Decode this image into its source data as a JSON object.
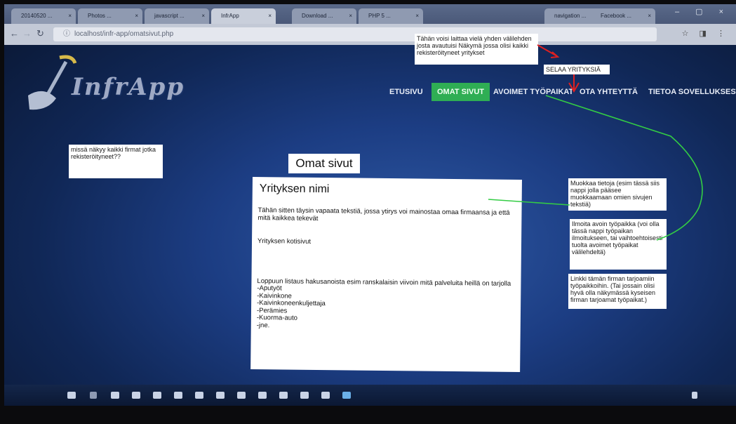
{
  "browser": {
    "tabs": [
      {
        "label": "20140520 ..."
      },
      {
        "label": "Photos ..."
      },
      {
        "label": "javascript ..."
      },
      {
        "label": "InfrApp"
      },
      {
        "label": "Download ..."
      },
      {
        "label": "PHP 5 ..."
      },
      {
        "label": "navigation ..."
      },
      {
        "label": "Facebook ..."
      }
    ],
    "url": "localhost/infr-app/omatsivut.php"
  },
  "site": {
    "logo": "InfrApp",
    "nav": [
      {
        "label": "ETUSIVU"
      },
      {
        "label": "OMAT SIVUT",
        "active": true
      },
      {
        "label": "AVOIMET TYÖPAIKAT"
      },
      {
        "label": "OTA YHTEYTTÄ"
      },
      {
        "label": "TIETOA SOVELLUKSESTA"
      }
    ]
  },
  "page": {
    "title": "Omat sivut",
    "company_name": "Yrityksen nimi",
    "description": "Tähän sitten täysin vapaata tekstiä, jossa ytirys voi mainostaa omaa firmaansa ja että mitä kaikkea tekevät",
    "homepage_label": "Yrityksen kotisivut",
    "list_intro": "Loppuun listaus hakusanoista esim ranskalaisin viivoin mitä palveluita heillä on tarjolla",
    "list_items": [
      "-Aputyöt",
      "-Kaivinkone",
      "-Kaivinkoneenkuljettaja",
      "-Perämies",
      "-Kuorma-auto",
      "-jne."
    ]
  },
  "notes": {
    "new_tab": "Tähän voisi laittaa vielä yhden välilehden josta avautuisi Näkymä jossa olisi kaikki rekisteröityneet yritykset",
    "browse_companies": "SELAA YRITYKSIÄ",
    "all_companies": "missä näkyy kaikki firmat jotka rekisteröityneet??",
    "edit_info": "Muokkaa tietoja (esim tässä siis nappi jolla pääsee muokkaamaan omien sivujen tekstiä)",
    "report_job": "Ilmoita avoin työpaikka (voi olla tässä nappi työpaikan ilmoitukseen, tai vaihtoehtoisesti tuolta avoimet työpaikat välilehdeltä)",
    "link_jobs": "Linkki tämän firman tarjoamiin työpaikkoihin. (Tai jossain olisi hyvä olla näkymässä kyseisen firman tarjoamat työpaikat.)"
  },
  "colors": {
    "active_nav": "#2fae54",
    "annotation_arrow": "#e02020",
    "annotation_line": "#33cc44"
  }
}
